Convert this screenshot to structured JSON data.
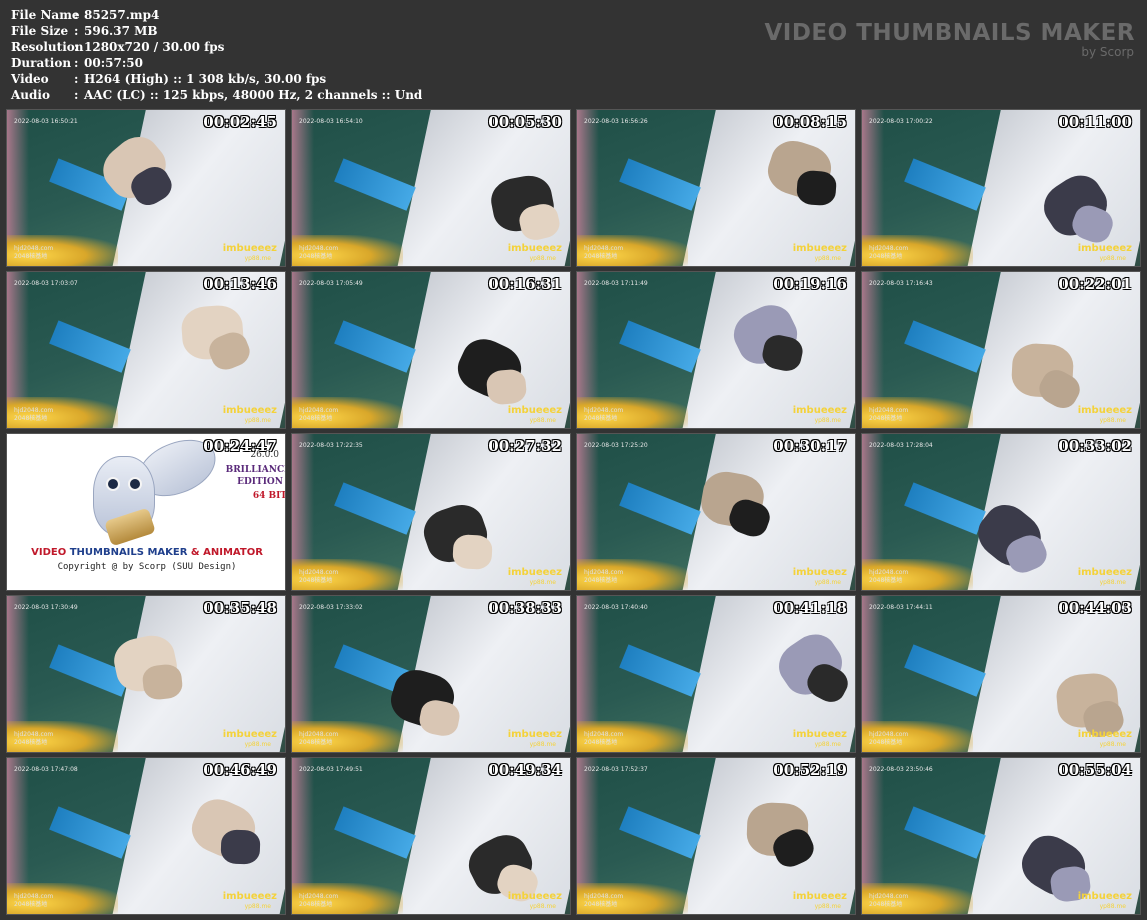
{
  "header": {
    "fields": [
      {
        "label": "File Name",
        "sep": ":",
        "value": "85257.mp4"
      },
      {
        "label": "File Size",
        "sep": ":",
        "value": "596.37 MB"
      },
      {
        "label": "Resolution",
        "sep": ":",
        "value": "1280x720 / 30.00 fps"
      },
      {
        "label": "Duration",
        "sep": ":",
        "value": "00:57:50"
      },
      {
        "label": "Video",
        "sep": ":",
        "value": "H264 (High) :: 1 308 kb/s, 30.00 fps"
      },
      {
        "label": "Audio",
        "sep": ":",
        "value": "AAC (LC) :: 125 kbps, 48000 Hz, 2 channels :: Und"
      }
    ],
    "brand_title": "VIDEO THUMBNAILS MAKER",
    "brand_sub": "by Scorp"
  },
  "watermarks": {
    "site": "hjd2048.com",
    "site_cn": "2048核基地",
    "logo": "imbueeez",
    "logo_sub": "yp88.me"
  },
  "thumbnails": [
    {
      "time": "00:02:45",
      "cam": "2022-08-03 16:50:21"
    },
    {
      "time": "00:05:30",
      "cam": "2022-08-03 16:54:10"
    },
    {
      "time": "00:08:15",
      "cam": "2022-08-03 16:56:26"
    },
    {
      "time": "00:11:00",
      "cam": "2022-08-03 17:00:22"
    },
    {
      "time": "00:13:46",
      "cam": "2022-08-03 17:03:07"
    },
    {
      "time": "00:16:31",
      "cam": "2022-08-03 17:05:49"
    },
    {
      "time": "00:19:16",
      "cam": "2022-08-03 17:11:49"
    },
    {
      "time": "00:22:01",
      "cam": "2022-08-03 17:16:43"
    },
    {
      "time": "00:24:47",
      "cam": "",
      "logo": true
    },
    {
      "time": "00:27:32",
      "cam": "2022-08-03 17:22:35"
    },
    {
      "time": "00:30:17",
      "cam": "2022-08-03 17:25:20"
    },
    {
      "time": "00:33:02",
      "cam": "2022-08-03 17:28:04"
    },
    {
      "time": "00:35:48",
      "cam": "2022-08-03 17:30:49"
    },
    {
      "time": "00:38:33",
      "cam": "2022-08-03 17:33:02"
    },
    {
      "time": "00:41:18",
      "cam": "2022-08-03 17:40:40"
    },
    {
      "time": "00:44:03",
      "cam": "2022-08-03 17:44:11"
    },
    {
      "time": "00:46:49",
      "cam": "2022-08-03 17:47:08"
    },
    {
      "time": "00:49:34",
      "cam": "2022-08-03 17:49:51"
    },
    {
      "time": "00:52:19",
      "cam": "2022-08-03 17:52:37"
    },
    {
      "time": "00:55:04",
      "cam": "2022-08-03 23:50:46"
    }
  ],
  "logo_tile": {
    "line1_a": "VIDEO",
    "line1_b": "THUMBNAILS MAKER",
    "line1_c": "& ANIMATOR",
    "line2": "Copyright @ by Scorp (SUU Design)",
    "version": "26.0.0",
    "edition_a": "BRILLIANCE",
    "edition_b": "EDITION",
    "bits": "64 BIT"
  },
  "colors": {
    "background": "#333333",
    "brand": "#6a6a6a",
    "watermark_yellow": "#f4d23a",
    "logo_red": "#c0182a",
    "logo_blue": "#1f3f8c"
  }
}
